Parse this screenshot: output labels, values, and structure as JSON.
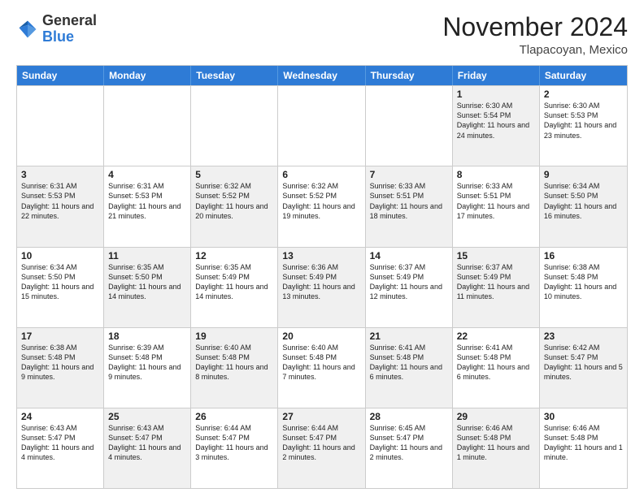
{
  "logo": {
    "general": "General",
    "blue": "Blue"
  },
  "title": "November 2024",
  "location": "Tlapacoyan, Mexico",
  "weekdays": [
    "Sunday",
    "Monday",
    "Tuesday",
    "Wednesday",
    "Thursday",
    "Friday",
    "Saturday"
  ],
  "rows": [
    [
      {
        "day": "",
        "info": "",
        "empty": true
      },
      {
        "day": "",
        "info": "",
        "empty": true
      },
      {
        "day": "",
        "info": "",
        "empty": true
      },
      {
        "day": "",
        "info": "",
        "empty": true
      },
      {
        "day": "",
        "info": "",
        "empty": true
      },
      {
        "day": "1",
        "info": "Sunrise: 6:30 AM\nSunset: 5:54 PM\nDaylight: 11 hours and 24 minutes.",
        "shaded": true
      },
      {
        "day": "2",
        "info": "Sunrise: 6:30 AM\nSunset: 5:53 PM\nDaylight: 11 hours and 23 minutes.",
        "shaded": false
      }
    ],
    [
      {
        "day": "3",
        "info": "Sunrise: 6:31 AM\nSunset: 5:53 PM\nDaylight: 11 hours and 22 minutes.",
        "shaded": true
      },
      {
        "day": "4",
        "info": "Sunrise: 6:31 AM\nSunset: 5:53 PM\nDaylight: 11 hours and 21 minutes.",
        "shaded": false
      },
      {
        "day": "5",
        "info": "Sunrise: 6:32 AM\nSunset: 5:52 PM\nDaylight: 11 hours and 20 minutes.",
        "shaded": true
      },
      {
        "day": "6",
        "info": "Sunrise: 6:32 AM\nSunset: 5:52 PM\nDaylight: 11 hours and 19 minutes.",
        "shaded": false
      },
      {
        "day": "7",
        "info": "Sunrise: 6:33 AM\nSunset: 5:51 PM\nDaylight: 11 hours and 18 minutes.",
        "shaded": true
      },
      {
        "day": "8",
        "info": "Sunrise: 6:33 AM\nSunset: 5:51 PM\nDaylight: 11 hours and 17 minutes.",
        "shaded": false
      },
      {
        "day": "9",
        "info": "Sunrise: 6:34 AM\nSunset: 5:50 PM\nDaylight: 11 hours and 16 minutes.",
        "shaded": true
      }
    ],
    [
      {
        "day": "10",
        "info": "Sunrise: 6:34 AM\nSunset: 5:50 PM\nDaylight: 11 hours and 15 minutes.",
        "shaded": false
      },
      {
        "day": "11",
        "info": "Sunrise: 6:35 AM\nSunset: 5:50 PM\nDaylight: 11 hours and 14 minutes.",
        "shaded": true
      },
      {
        "day": "12",
        "info": "Sunrise: 6:35 AM\nSunset: 5:49 PM\nDaylight: 11 hours and 14 minutes.",
        "shaded": false
      },
      {
        "day": "13",
        "info": "Sunrise: 6:36 AM\nSunset: 5:49 PM\nDaylight: 11 hours and 13 minutes.",
        "shaded": true
      },
      {
        "day": "14",
        "info": "Sunrise: 6:37 AM\nSunset: 5:49 PM\nDaylight: 11 hours and 12 minutes.",
        "shaded": false
      },
      {
        "day": "15",
        "info": "Sunrise: 6:37 AM\nSunset: 5:49 PM\nDaylight: 11 hours and 11 minutes.",
        "shaded": true
      },
      {
        "day": "16",
        "info": "Sunrise: 6:38 AM\nSunset: 5:48 PM\nDaylight: 11 hours and 10 minutes.",
        "shaded": false
      }
    ],
    [
      {
        "day": "17",
        "info": "Sunrise: 6:38 AM\nSunset: 5:48 PM\nDaylight: 11 hours and 9 minutes.",
        "shaded": true
      },
      {
        "day": "18",
        "info": "Sunrise: 6:39 AM\nSunset: 5:48 PM\nDaylight: 11 hours and 9 minutes.",
        "shaded": false
      },
      {
        "day": "19",
        "info": "Sunrise: 6:40 AM\nSunset: 5:48 PM\nDaylight: 11 hours and 8 minutes.",
        "shaded": true
      },
      {
        "day": "20",
        "info": "Sunrise: 6:40 AM\nSunset: 5:48 PM\nDaylight: 11 hours and 7 minutes.",
        "shaded": false
      },
      {
        "day": "21",
        "info": "Sunrise: 6:41 AM\nSunset: 5:48 PM\nDaylight: 11 hours and 6 minutes.",
        "shaded": true
      },
      {
        "day": "22",
        "info": "Sunrise: 6:41 AM\nSunset: 5:48 PM\nDaylight: 11 hours and 6 minutes.",
        "shaded": false
      },
      {
        "day": "23",
        "info": "Sunrise: 6:42 AM\nSunset: 5:47 PM\nDaylight: 11 hours and 5 minutes.",
        "shaded": true
      }
    ],
    [
      {
        "day": "24",
        "info": "Sunrise: 6:43 AM\nSunset: 5:47 PM\nDaylight: 11 hours and 4 minutes.",
        "shaded": false
      },
      {
        "day": "25",
        "info": "Sunrise: 6:43 AM\nSunset: 5:47 PM\nDaylight: 11 hours and 4 minutes.",
        "shaded": true
      },
      {
        "day": "26",
        "info": "Sunrise: 6:44 AM\nSunset: 5:47 PM\nDaylight: 11 hours and 3 minutes.",
        "shaded": false
      },
      {
        "day": "27",
        "info": "Sunrise: 6:44 AM\nSunset: 5:47 PM\nDaylight: 11 hours and 2 minutes.",
        "shaded": true
      },
      {
        "day": "28",
        "info": "Sunrise: 6:45 AM\nSunset: 5:47 PM\nDaylight: 11 hours and 2 minutes.",
        "shaded": false
      },
      {
        "day": "29",
        "info": "Sunrise: 6:46 AM\nSunset: 5:48 PM\nDaylight: 11 hours and 1 minute.",
        "shaded": true
      },
      {
        "day": "30",
        "info": "Sunrise: 6:46 AM\nSunset: 5:48 PM\nDaylight: 11 hours and 1 minute.",
        "shaded": false
      }
    ]
  ]
}
